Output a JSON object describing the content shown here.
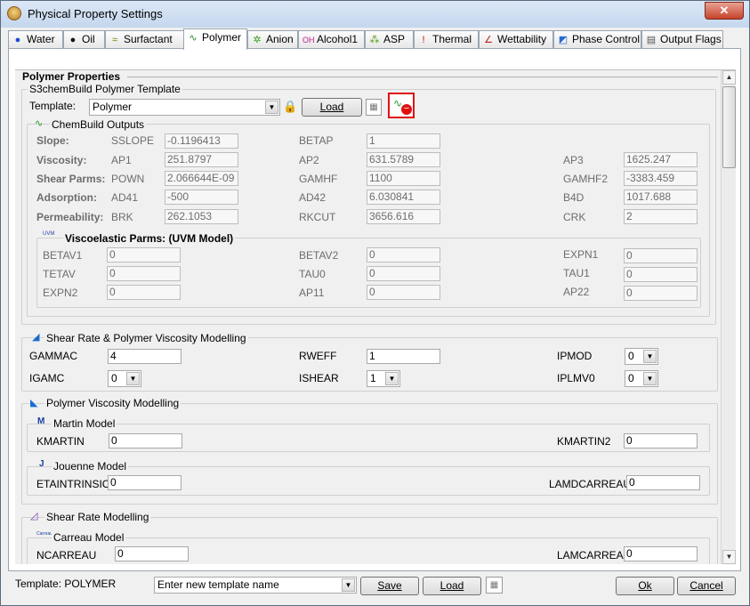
{
  "window": {
    "title": "Physical Property Settings",
    "close_glyph": "✕"
  },
  "tabs": [
    {
      "label": "Water",
      "icon": "water-drop-icon"
    },
    {
      "label": "Oil",
      "icon": "oil-drop-icon"
    },
    {
      "label": "Surfactant",
      "icon": "surfactant-icon"
    },
    {
      "label": "Polymer",
      "icon": "polymer-icon"
    },
    {
      "label": "Anion",
      "icon": "anion-icon"
    },
    {
      "label": "Alcohol1",
      "icon": "alcohol-icon"
    },
    {
      "label": "ASP",
      "icon": "asp-icon"
    },
    {
      "label": "Thermal",
      "icon": "thermometer-icon"
    },
    {
      "label": "Wettability",
      "icon": "wettability-icon"
    },
    {
      "label": "Phase Control",
      "icon": "phase-control-icon"
    },
    {
      "label": "Output Flags",
      "icon": "output-flags-icon"
    }
  ],
  "polymer": {
    "heading": "Polymer Properties",
    "template_group": "S3chemBuild Polymer Template",
    "template_label": "Template:",
    "template_value": "Polymer",
    "load_label": "Load",
    "chembuild": {
      "title": "ChemBuild Outputs",
      "rows": {
        "slope": {
          "label": "Slope:",
          "p1": "SSLOPE",
          "v1": "-0.1196413",
          "p2": "BETAP",
          "v2": "1"
        },
        "viscosity": {
          "label": "Viscosity:",
          "p1": "AP1",
          "v1": "251.8797",
          "p2": "AP2",
          "v2": "631.5789",
          "p3": "AP3",
          "v3": "1625.247"
        },
        "shear": {
          "label": "Shear Parms:",
          "p1": "POWN",
          "v1": "2.066644E-09",
          "p2": "GAMHF",
          "v2": "1100",
          "p3": "GAMHF2",
          "v3": "-3383.459"
        },
        "adsorption": {
          "label": "Adsorption:",
          "p1": "AD41",
          "v1": "-500",
          "p2": "AD42",
          "v2": "6.030841",
          "p3": "B4D",
          "v3": "1017.688"
        },
        "permeability": {
          "label": "Permeability:",
          "p1": "BRK",
          "v1": "262.1053",
          "p2": "RKCUT",
          "v2": "3656.616",
          "p3": "CRK",
          "v3": "2"
        }
      },
      "visco": {
        "title": "Viscoelastic Parms: (UVM Model)",
        "icon_text": "UVM",
        "rows": [
          {
            "p1": "BETAV1",
            "v1": "0",
            "p2": "BETAV2",
            "v2": "0",
            "p3": "EXPN1",
            "v3": "0"
          },
          {
            "p1": "TETAV",
            "v1": "0",
            "p2": "TAU0",
            "v2": "0",
            "p3": "TAU1",
            "v3": "0"
          },
          {
            "p1": "EXPN2",
            "v1": "0",
            "p2": "AP11",
            "v2": "0",
            "p3": "AP22",
            "v3": "0"
          }
        ]
      }
    }
  },
  "shear_rate_visc": {
    "title": "Shear Rate & Polymer Viscosity Modelling",
    "gammac_label": "GAMMAC",
    "gammac": "4",
    "rweff_label": "RWEFF",
    "rweff": "1",
    "ipmod_label": "IPMOD",
    "ipmod": "0",
    "igamc_label": "IGAMC",
    "igamc": "0",
    "ishear_label": "ISHEAR",
    "ishear": "1",
    "iplmv0_label": "IPLMV0",
    "iplmv0": "0"
  },
  "polymer_visc": {
    "title": "Polymer Viscosity Modelling",
    "martin": {
      "title": "Martin Model",
      "k1_label": "KMARTIN",
      "k1": "0",
      "k2_label": "KMARTIN2",
      "k2": "0"
    },
    "jouenne": {
      "title": "Jouenne Model",
      "e_label": "ETAINTRINSIC",
      "e": "0",
      "l_label": "LAMDCARREAU",
      "l": "0"
    }
  },
  "shear_rate_model": {
    "title": "Shear Rate Modelling",
    "carreau": {
      "title": "Carreau Model",
      "icon_text": "Carreau",
      "n_label": "NCARREAU",
      "n": "0",
      "l_label": "LAMCARREAU",
      "l": "0"
    }
  },
  "footer": {
    "template_status": "Template: POLYMER",
    "new_template_placeholder": "Enter new template name",
    "save_label": "Save",
    "load_label": "Load",
    "ok_label": "Ok",
    "cancel_label": "Cancel"
  },
  "colors": {
    "accent_red": "#e01010",
    "title_bg": "#c5d7ee",
    "border": "#9aa5b3"
  }
}
